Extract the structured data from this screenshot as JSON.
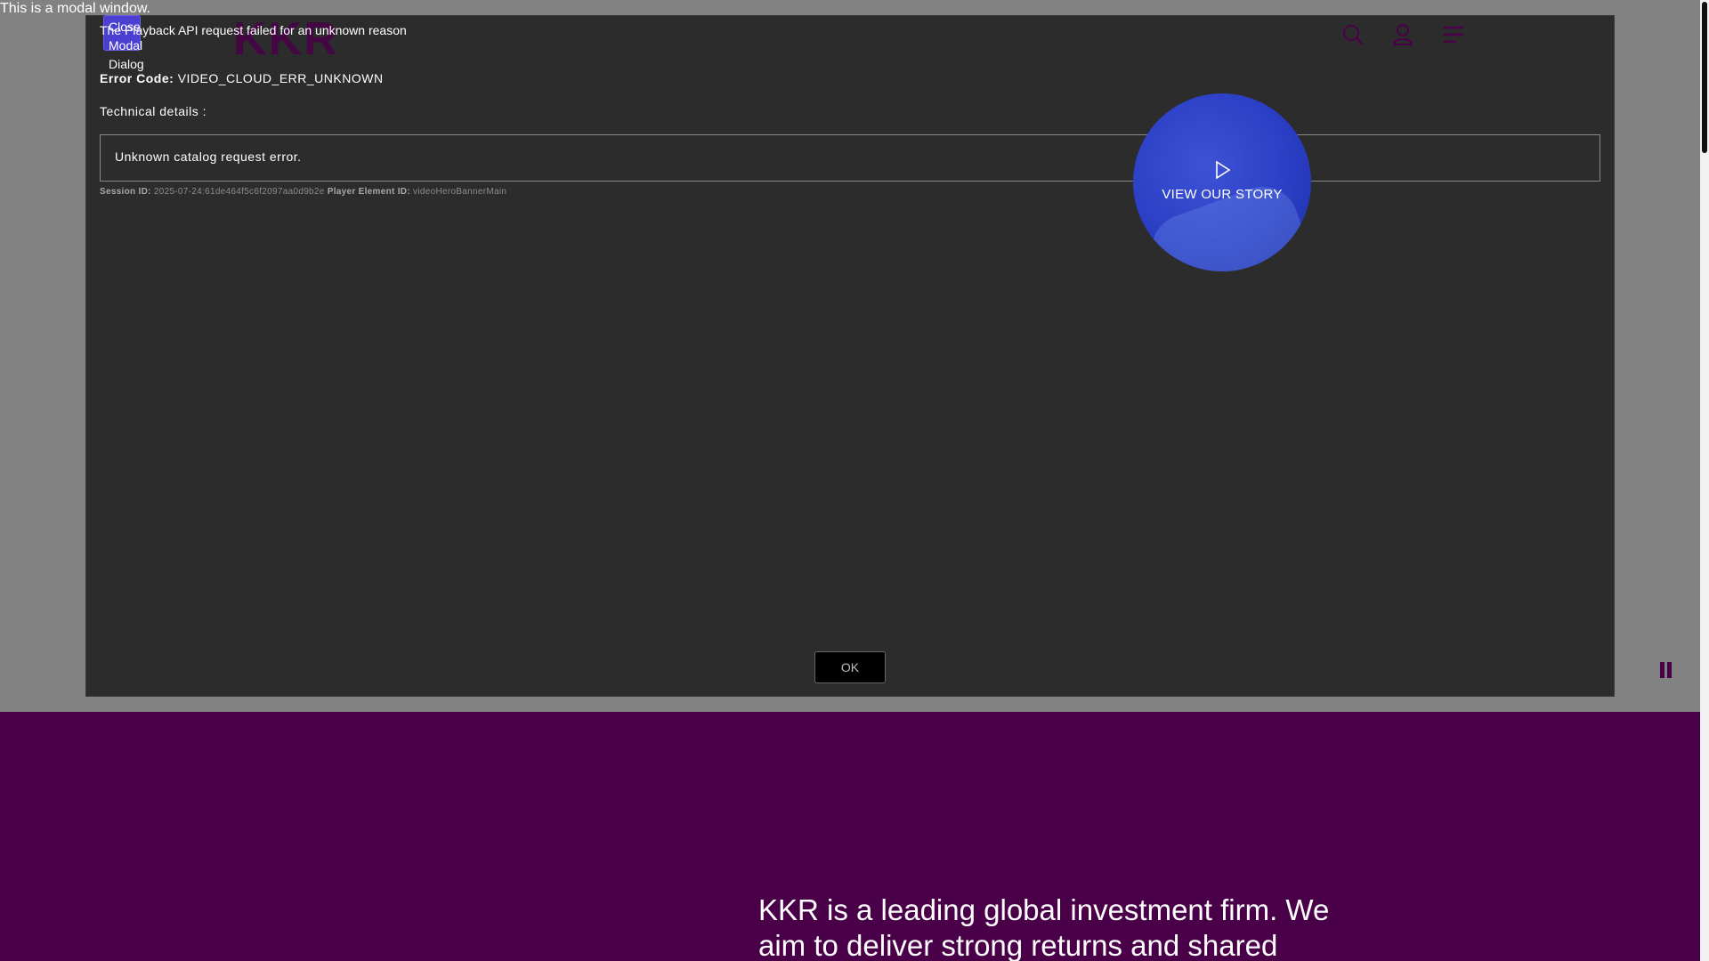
{
  "modal": {
    "announce": "This is a modal window.",
    "close_label": "Close Modal Dialog",
    "error_message": "The Playback API request failed for an unknown reason",
    "error_code_label": "Error Code:",
    "error_code_value": "VIDEO_CLOUD_ERR_UNKNOWN",
    "tech_details_label": "Technical details :",
    "tech_details_text": "Unknown catalog request error.",
    "session_label": "Session ID:",
    "session_value": "2025-07-24:61de464f5c6f2097aa0d9b2e",
    "player_label": "Player Element ID:",
    "player_value": "videoHeroBannerMain",
    "ok_label": "OK"
  },
  "header": {
    "logo": "KKR",
    "icons": [
      "search-icon",
      "user-icon",
      "menu-icon"
    ]
  },
  "hero": {
    "cta_label": "VIEW OUR STORY",
    "pause_icon": "pause-icon"
  },
  "intro": {
    "text": "KKR is a leading global investment firm. We aim to deliver strong returns and shared success to"
  },
  "colors": {
    "brand": "#4a0049",
    "modal_bg": "#2c2c2c",
    "cta": "#2b3fc6",
    "close_button": "#4a3fd0"
  }
}
